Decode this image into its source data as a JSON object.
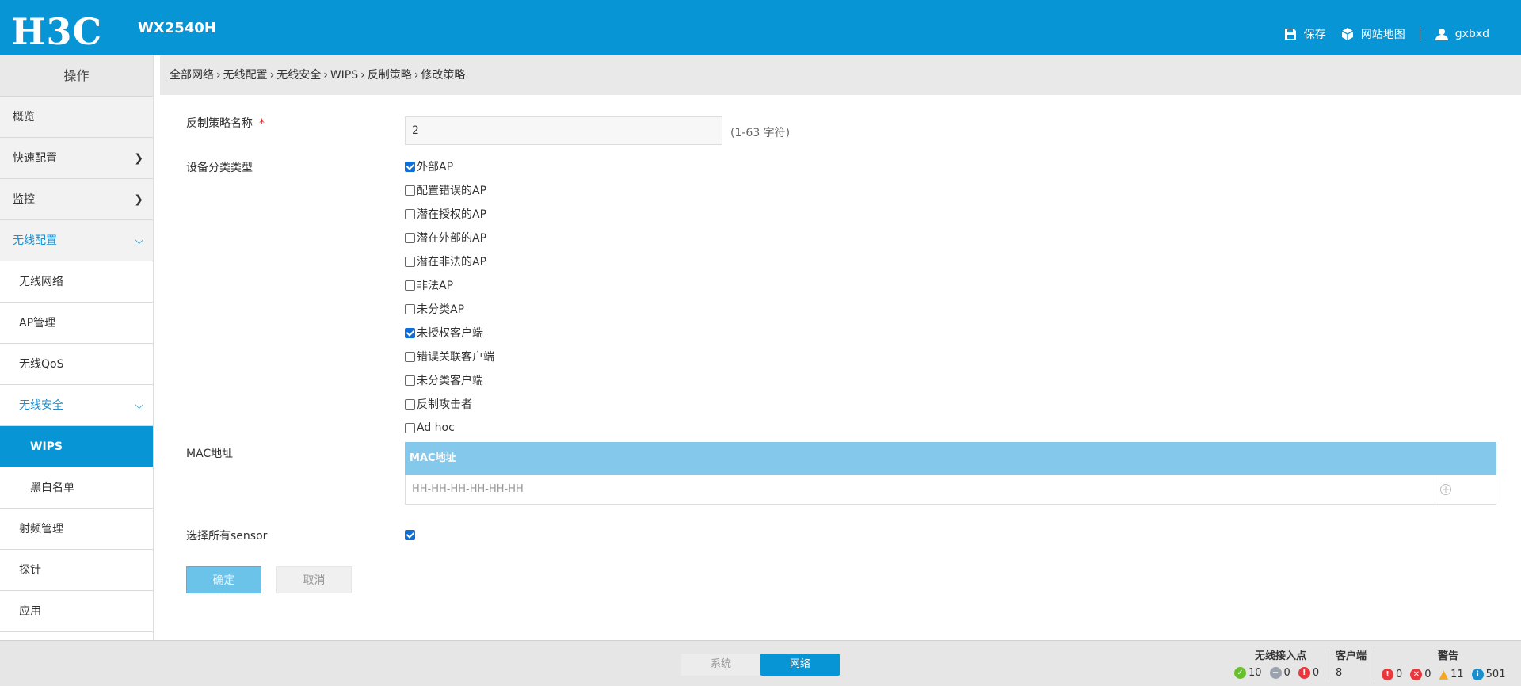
{
  "header": {
    "logo": "H3C",
    "model": "WX2540H",
    "save_label": "保存",
    "sitemap_label": "网站地图",
    "user_label": "gxbxd"
  },
  "sidebar": {
    "title": "操作",
    "items": [
      {
        "label": "概览"
      },
      {
        "label": "快速配置"
      },
      {
        "label": "监控"
      },
      {
        "label": "无线配置"
      },
      {
        "label": "无线网络"
      },
      {
        "label": "AP管理"
      },
      {
        "label": "无线QoS"
      },
      {
        "label": "无线安全"
      },
      {
        "label": "WIPS"
      },
      {
        "label": "黑白名单"
      },
      {
        "label": "射频管理"
      },
      {
        "label": "探针"
      },
      {
        "label": "应用"
      }
    ]
  },
  "breadcrumb": [
    "全部网络",
    "无线配置",
    "无线安全",
    "WIPS",
    "反制策略",
    "修改策略"
  ],
  "form": {
    "name_label": "反制策略名称",
    "required_mark": "*",
    "name_value": "2",
    "name_hint": "(1-63 字符)",
    "device_type_label": "设备分类类型",
    "device_types": [
      {
        "label": "外部AP",
        "checked": true
      },
      {
        "label": "配置错误的AP",
        "checked": false
      },
      {
        "label": "潜在授权的AP",
        "checked": false
      },
      {
        "label": "潜在外部的AP",
        "checked": false
      },
      {
        "label": "潜在非法的AP",
        "checked": false
      },
      {
        "label": "非法AP",
        "checked": false
      },
      {
        "label": "未分类AP",
        "checked": false
      },
      {
        "label": "未授权客户端",
        "checked": true
      },
      {
        "label": "错误关联客户端",
        "checked": false
      },
      {
        "label": "未分类客户端",
        "checked": false
      },
      {
        "label": "反制攻击者",
        "checked": false
      },
      {
        "label": "Ad hoc",
        "checked": false
      }
    ],
    "mac_label": "MAC地址",
    "mac_column": "MAC地址",
    "mac_placeholder": "HH-HH-HH-HH-HH-HH",
    "sensor_label": "选择所有sensor",
    "sensor_checked": true,
    "ok_label": "确定",
    "cancel_label": "取消"
  },
  "footer": {
    "tab_system": "系统",
    "tab_network": "网络",
    "ap_title": "无线接入点",
    "ap_online": "10",
    "ap_offline": "0",
    "ap_error": "0",
    "client_title": "客户端",
    "client_count": "8",
    "alarm_title": "警告",
    "alarm_critical": "0",
    "alarm_major": "0",
    "alarm_warning": "11",
    "alarm_info": "501"
  }
}
